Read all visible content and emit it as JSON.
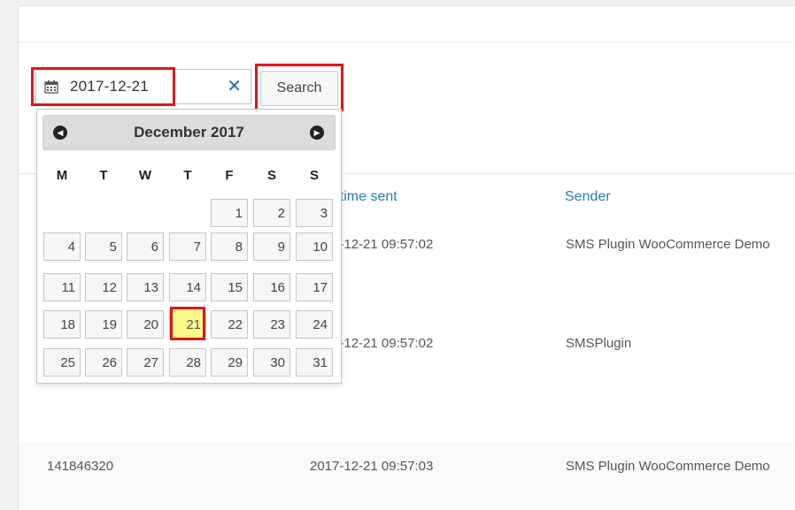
{
  "search": {
    "date_value": "2017-12-21",
    "clear_label": "✕",
    "button_label": "Search"
  },
  "calendar": {
    "month_title": "December 2017",
    "weekdays": [
      "M",
      "T",
      "W",
      "T",
      "F",
      "S",
      "S"
    ],
    "weeks": [
      [
        "",
        "",
        "",
        "",
        "1",
        "2",
        "3"
      ],
      [
        "4",
        "5",
        "6",
        "7",
        "8",
        "9",
        "10"
      ],
      [
        "11",
        "12",
        "13",
        "14",
        "15",
        "16",
        "17"
      ],
      [
        "18",
        "19",
        "20",
        "21",
        "22",
        "23",
        "24"
      ],
      [
        "25",
        "26",
        "27",
        "28",
        "29",
        "30",
        "31"
      ]
    ],
    "selected_day": "21"
  },
  "table": {
    "columns": {
      "datetime_sent": "Datetime sent",
      "sender": "Sender"
    },
    "rows": [
      {
        "id": "",
        "datetime": "2017-12-21 09:57:02",
        "sender": "SMS Plugin WooCommerce Demo"
      },
      {
        "id": "",
        "datetime": "2017-12-21 09:57:02",
        "sender": "SMSPlugin"
      },
      {
        "id": "141846320",
        "datetime": "2017-12-21 09:57:03",
        "sender": "SMS Plugin WooCommerce Demo"
      }
    ]
  },
  "colors": {
    "highlight": "#e0141b",
    "link": "#2a7ab0",
    "today": "#fdf88a"
  }
}
